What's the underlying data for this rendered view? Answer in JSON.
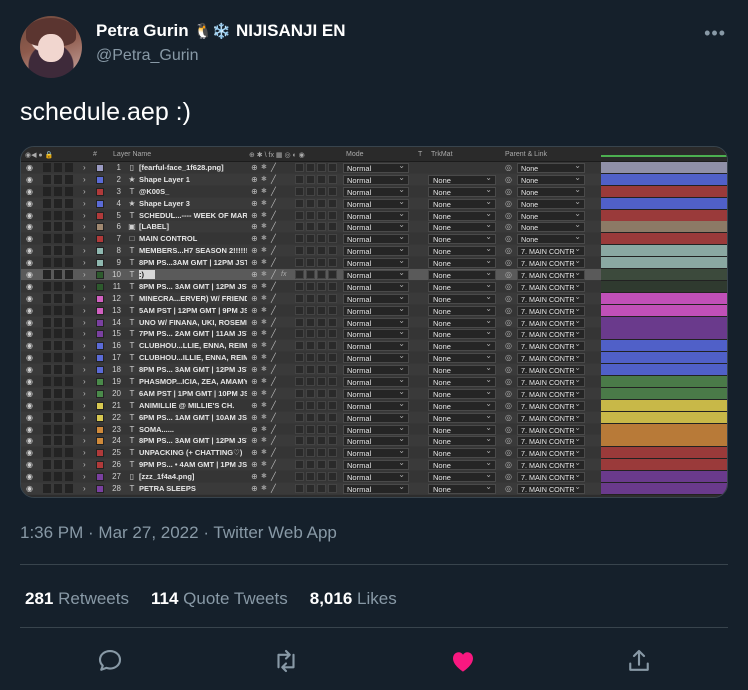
{
  "author": {
    "name": "Petra Gurin",
    "emoji": "🐧❄️",
    "org": "NIJISANJI EN",
    "handle": "@Petra_Gurin"
  },
  "more_label": "•••",
  "tweet_text": "schedule.aep :)",
  "ae": {
    "header": {
      "layer_name": "Layer Name",
      "mode": "Mode",
      "t": "T",
      "trkmat": "TrkMat",
      "parent": "Parent & Link",
      "num": "#"
    },
    "rows": [
      {
        "num": "1",
        "label": "#9a9ac2",
        "icon": "▯",
        "name": "[fearful-face_1f628.png]",
        "mode": "Normal",
        "trk": "",
        "parent": "None",
        "bar": "#9090a8"
      },
      {
        "num": "2",
        "label": "#5b6bd6",
        "icon": "★",
        "name": "Shape Layer 1",
        "mode": "Normal",
        "trk": "None",
        "parent": "None",
        "bar": "#5060c8"
      },
      {
        "num": "3",
        "label": "#b03a3a",
        "icon": "T",
        "name": "@K00S_",
        "mode": "Normal",
        "trk": "None",
        "parent": "None",
        "bar": "#9a3a3a"
      },
      {
        "num": "4",
        "label": "#5b6bd6",
        "icon": "★",
        "name": "Shape Layer 3",
        "mode": "Normal",
        "trk": "None",
        "parent": "None",
        "bar": "#5060c8"
      },
      {
        "num": "5",
        "label": "#b03a3a",
        "icon": "T",
        "name": "SCHEDUL...---- WEEK OF MAR 27",
        "mode": "Normal",
        "trk": "None",
        "parent": "None",
        "bar": "#9a3a3a"
      },
      {
        "num": "6",
        "label": "#a08870",
        "icon": "▣",
        "name": "[LABEL]",
        "mode": "Normal",
        "trk": "None",
        "parent": "None",
        "bar": "#8c7a66"
      },
      {
        "num": "7",
        "label": "#b03a3a",
        "icon": "□",
        "name": "MAIN CONTROL",
        "mode": "Normal",
        "trk": "None",
        "parent": "None",
        "bar": "#9a3a3a"
      },
      {
        "num": "8",
        "label": "#8fb8b0",
        "icon": "T",
        "name": "MEMBERS...H7 SEASON 2!!!!!!!!!",
        "mode": "Normal",
        "trk": "None",
        "parent": "7. MAIN CONTR",
        "bar": "#8aa8a2"
      },
      {
        "num": "9",
        "label": "#8fb8b0",
        "icon": "T",
        "name": "8PM PS...3AM GMT | 12PM JST 2",
        "mode": "Normal",
        "trk": "None",
        "parent": "7. MAIN CONTR",
        "bar": "#8aa8a2"
      },
      {
        "num": "10",
        "label": "#2d5a2d",
        "icon": "T",
        "name": ":)",
        "mode": "Normal",
        "trk": "None",
        "parent": "7. MAIN CONTR",
        "bar": "#3c4a3c",
        "sel": true
      },
      {
        "num": "11",
        "label": "#2d5a2d",
        "icon": "T",
        "name": "8PM PS... 3AM GMT | 12PM JST",
        "mode": "Normal",
        "trk": "None",
        "parent": "7. MAIN CONTR",
        "bar": "#2f3a2f"
      },
      {
        "num": "12",
        "label": "#d060c0",
        "icon": "T",
        "name": "MINECRA...ERVER) W/ FRIENDS!",
        "mode": "Normal",
        "trk": "None",
        "parent": "7. MAIN CONTR",
        "bar": "#c050b8"
      },
      {
        "num": "13",
        "label": "#d060c0",
        "icon": "T",
        "name": "5AM PST | 12PM GMT | 9PM JST",
        "mode": "Normal",
        "trk": "None",
        "parent": "7. MAIN CONTR",
        "bar": "#c050b8"
      },
      {
        "num": "14",
        "label": "#7a40a0",
        "icon": "T",
        "name": "UNO W/ FINANA, UKI, ROSEMI 2",
        "mode": "Normal",
        "trk": "None",
        "parent": "7. MAIN CONTR",
        "bar": "#6a3a8c"
      },
      {
        "num": "15",
        "label": "#7a40a0",
        "icon": "T",
        "name": "7PM PS... 2AM GMT | 11AM JST",
        "mode": "Normal",
        "trk": "None",
        "parent": "7. MAIN CONTR",
        "bar": "#6a3a8c"
      },
      {
        "num": "16",
        "label": "#5b6bd6",
        "icon": "T",
        "name": "CLUBHOU...LLIE, ENNA, REIMU 2",
        "mode": "Normal",
        "trk": "None",
        "parent": "7. MAIN CONTR",
        "bar": "#5060c8"
      },
      {
        "num": "17",
        "label": "#5b6bd6",
        "icon": "T",
        "name": "CLUBHOU...ILLIE, ENNA, REIMU",
        "mode": "Normal",
        "trk": "None",
        "parent": "7. MAIN CONTR",
        "bar": "#5060c8"
      },
      {
        "num": "18",
        "label": "#5b6bd6",
        "icon": "T",
        "name": "8PM PS... 3AM GMT | 12PM JST",
        "mode": "Normal",
        "trk": "None",
        "parent": "7. MAIN CONTR",
        "bar": "#5060c8"
      },
      {
        "num": "19",
        "label": "#4a8a4a",
        "icon": "T",
        "name": "PHASMOP...ICIA, ZEA, AMAMYA",
        "mode": "Normal",
        "trk": "None",
        "parent": "7. MAIN CONTR",
        "bar": "#4a7a48"
      },
      {
        "num": "20",
        "label": "#4a8a4a",
        "icon": "T",
        "name": "6AM PST | 1PM GMT | 10PM JST",
        "mode": "Normal",
        "trk": "None",
        "parent": "7. MAIN CONTR",
        "bar": "#4a7a48"
      },
      {
        "num": "21",
        "label": "#d8c850",
        "icon": "T",
        "name": "ANIMILLIE @ MILLIE'S CH.",
        "mode": "Normal",
        "trk": "None",
        "parent": "7. MAIN CONTR",
        "bar": "#c8b848"
      },
      {
        "num": "22",
        "label": "#d8c850",
        "icon": "T",
        "name": "6PM PS... 1AM GMT | 10AM JST",
        "mode": "Normal",
        "trk": "None",
        "parent": "7. MAIN CONTR",
        "bar": "#c8b848"
      },
      {
        "num": "23",
        "label": "#d08a3a",
        "icon": "T",
        "name": "SOMA......",
        "mode": "Normal",
        "trk": "None",
        "parent": "7. MAIN CONTR",
        "bar": "#b87a38"
      },
      {
        "num": "24",
        "label": "#d08a3a",
        "icon": "T",
        "name": "8PM PS... 3AM GMT | 12PM JST",
        "mode": "Normal",
        "trk": "None",
        "parent": "7. MAIN CONTR",
        "bar": "#b87a38"
      },
      {
        "num": "25",
        "label": "#b03a3a",
        "icon": "T",
        "name": "UNPACKING (+ CHATTING♡)",
        "mode": "Normal",
        "trk": "None",
        "parent": "7. MAIN CONTR",
        "bar": "#9a3a3a"
      },
      {
        "num": "26",
        "label": "#b03a3a",
        "icon": "T",
        "name": "9PM PS... •  4AM GMT | 1PM JST",
        "mode": "Normal",
        "trk": "None",
        "parent": "7. MAIN CONTR",
        "bar": "#9a3a3a"
      },
      {
        "num": "27",
        "label": "#7a40a0",
        "icon": "▯",
        "name": "[zzz_1f4a4.png]",
        "mode": "Normal",
        "trk": "None",
        "parent": "7. MAIN CONTR",
        "bar": "#6a3a8c"
      },
      {
        "num": "28",
        "label": "#7a40a0",
        "icon": "T",
        "name": "PETRA SLEEPS",
        "mode": "Normal",
        "trk": "None",
        "parent": "7. MAIN CONTR",
        "bar": "#6a3a8c"
      }
    ]
  },
  "timestamp": "1:36 PM · Mar 27, 2022 · Twitter Web App",
  "stats": {
    "retweets_count": "281",
    "retweets_label": "Retweets",
    "quotes_count": "114",
    "quotes_label": "Quote Tweets",
    "likes_count": "8,016",
    "likes_label": "Likes"
  },
  "colors": {
    "background": "#15202b",
    "like": "#f91880",
    "secondary": "#8899a6"
  },
  "icons": {
    "reply": "reply-icon",
    "retweet": "retweet-icon",
    "like": "heart-icon",
    "share": "share-icon"
  }
}
